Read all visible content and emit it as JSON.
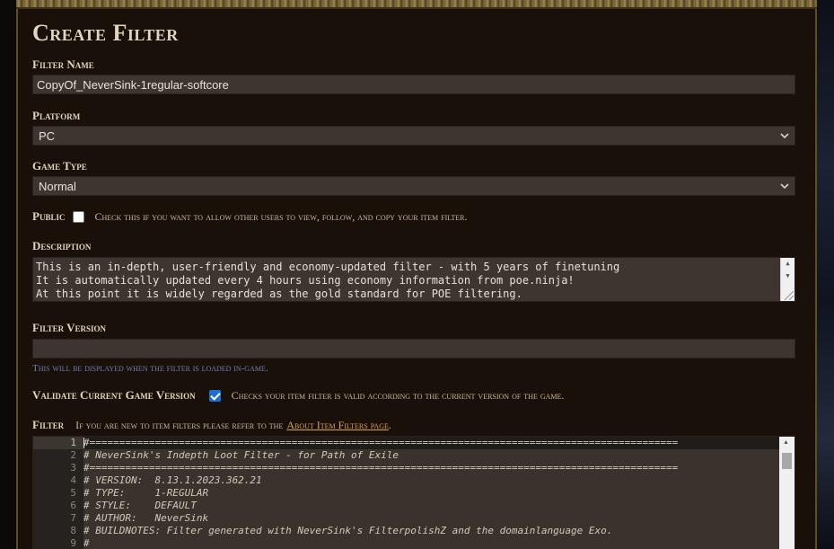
{
  "title": "Create Filter",
  "filter_name": {
    "label": "Filter Name",
    "value": "CopyOf_NeverSink-1regular-softcore"
  },
  "platform": {
    "label": "Platform",
    "value": "PC"
  },
  "game_type": {
    "label": "Game Type",
    "value": "Normal"
  },
  "public": {
    "label": "Public",
    "checked": false,
    "hint": "Check this if you want to allow other users to view, follow, and copy your item filter."
  },
  "description": {
    "label": "Description",
    "lines": [
      "This is an in-depth, user-friendly and economy-updated filter - with 5 years of finetuning",
      "It is automatically updated every 4 hours using economy information from poe.ninja!",
      "At this point it is widely regarded as the gold standard for POE filtering."
    ]
  },
  "filter_version": {
    "label": "Filter Version",
    "value": "",
    "note": "This will be displayed when the filter is loaded in-game."
  },
  "validate": {
    "label": "Validate Current Game Version",
    "checked": true,
    "hint": "Checks your item filter is valid according to the current version of the game."
  },
  "filter": {
    "label": "Filter",
    "hint_prefix": "If you are new to item filters please refer to the",
    "link": "About Item Filters page",
    "hint_suffix": ".",
    "lines": [
      {
        "n": "1",
        "text": "#==================================================================================================="
      },
      {
        "n": "2",
        "text": "# NeverSink's Indepth Loot Filter - for Path of Exile"
      },
      {
        "n": "3",
        "text": "#==================================================================================================="
      },
      {
        "n": "4",
        "text": "# VERSION:  8.13.1.2023.362.21"
      },
      {
        "n": "5",
        "text": "# TYPE:     1-REGULAR"
      },
      {
        "n": "6",
        "text": "# STYLE:    DEFAULT"
      },
      {
        "n": "7",
        "text": "# AUTHOR:   NeverSink"
      },
      {
        "n": "8",
        "text": "# BUILDNOTES: Filter generated with NeverSink's FilterpolishZ and the domainlanguage Exo."
      },
      {
        "n": "9",
        "text": "#"
      }
    ]
  }
}
